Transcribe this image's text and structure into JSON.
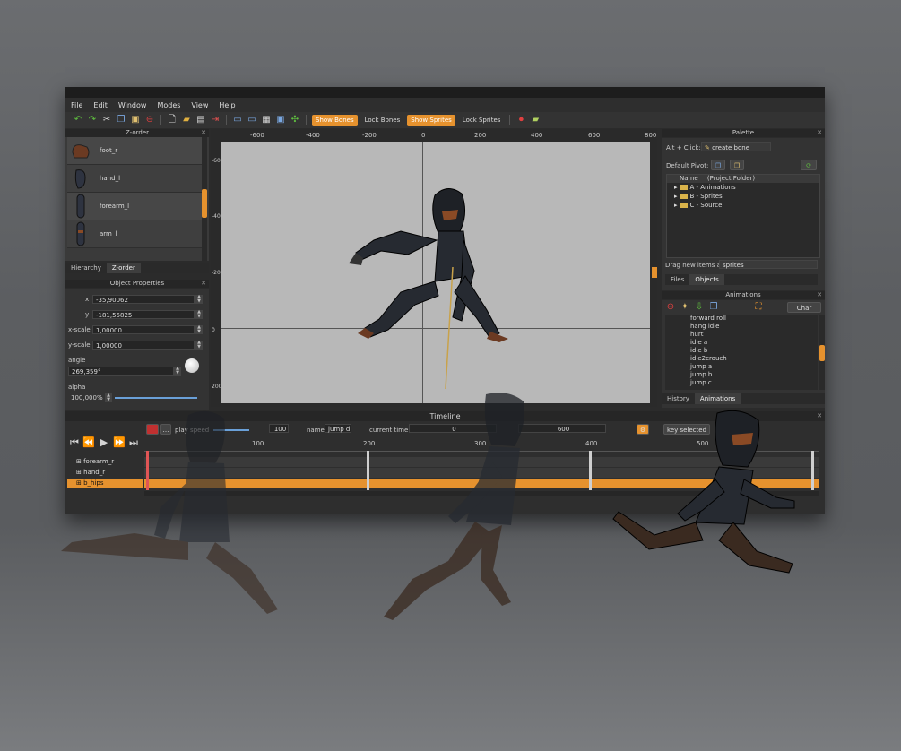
{
  "menu": [
    "File",
    "Edit",
    "Window",
    "Modes",
    "View",
    "Help"
  ],
  "toolbar": {
    "show_bones": "Show Bones",
    "lock_bones": "Lock Bones",
    "show_sprites": "Show Sprites",
    "lock_sprites": "Lock Sprites"
  },
  "zorder": {
    "title": "Z-order",
    "items": [
      "foot_r",
      "hand_l",
      "forearm_l",
      "arm_l"
    ],
    "tabs": [
      "Hierarchy",
      "Z-order"
    ]
  },
  "props": {
    "title": "Object Properties",
    "x_label": "x",
    "x_value": "-35,90062",
    "y_label": "y",
    "y_value": "-181,55825",
    "xscale_label": "x-scale",
    "xscale_value": "1,00000",
    "yscale_label": "y-scale",
    "yscale_value": "1,00000",
    "angle_label": "angle",
    "angle_value": "269,359°",
    "alpha_label": "alpha",
    "alpha_value": "100,000%"
  },
  "viewport": {
    "ruler_x": [
      "-600",
      "-400",
      "-200",
      "0",
      "200",
      "400",
      "600",
      "800"
    ],
    "ruler_y": [
      "-600",
      "-400",
      "-200",
      "0",
      "200"
    ]
  },
  "palette": {
    "title": "Palette",
    "alt_click_label": "Alt + Click:",
    "alt_click_value": "create bone",
    "default_pivot_label": "Default Pivot:",
    "col_name": "Name",
    "col_folder": "(Project Folder)",
    "items": [
      "A - Animations",
      "B - Sprites",
      "C - Source"
    ],
    "drag_label": "Drag new items as",
    "drag_value": "sprites",
    "tabs": [
      "Files",
      "Objects"
    ]
  },
  "animations": {
    "title": "Animations",
    "char_maps": "Char Maps",
    "items": [
      "forward roll",
      "hang idle",
      "hurt",
      "idle a",
      "idle b",
      "idle2crouch",
      "jump a",
      "jump b",
      "jump c"
    ],
    "tabs": [
      "History",
      "Animations"
    ]
  },
  "timeline": {
    "title": "Timeline",
    "play_speed_label": "play speed",
    "play_speed_value": "100",
    "name_label": "name",
    "name_value": "jump d",
    "current_time_label": "current time:",
    "current_time_value": "0",
    "end_time_value": "600",
    "key_selected": "key selected",
    "ruler": [
      "100",
      "200",
      "300",
      "400",
      "500"
    ],
    "tracks": [
      "forearm_r",
      "hand_r",
      "b_hips"
    ]
  },
  "colors": {
    "accent": "#e6922e",
    "panel": "#333333",
    "canvas": "#b8b8b8"
  }
}
